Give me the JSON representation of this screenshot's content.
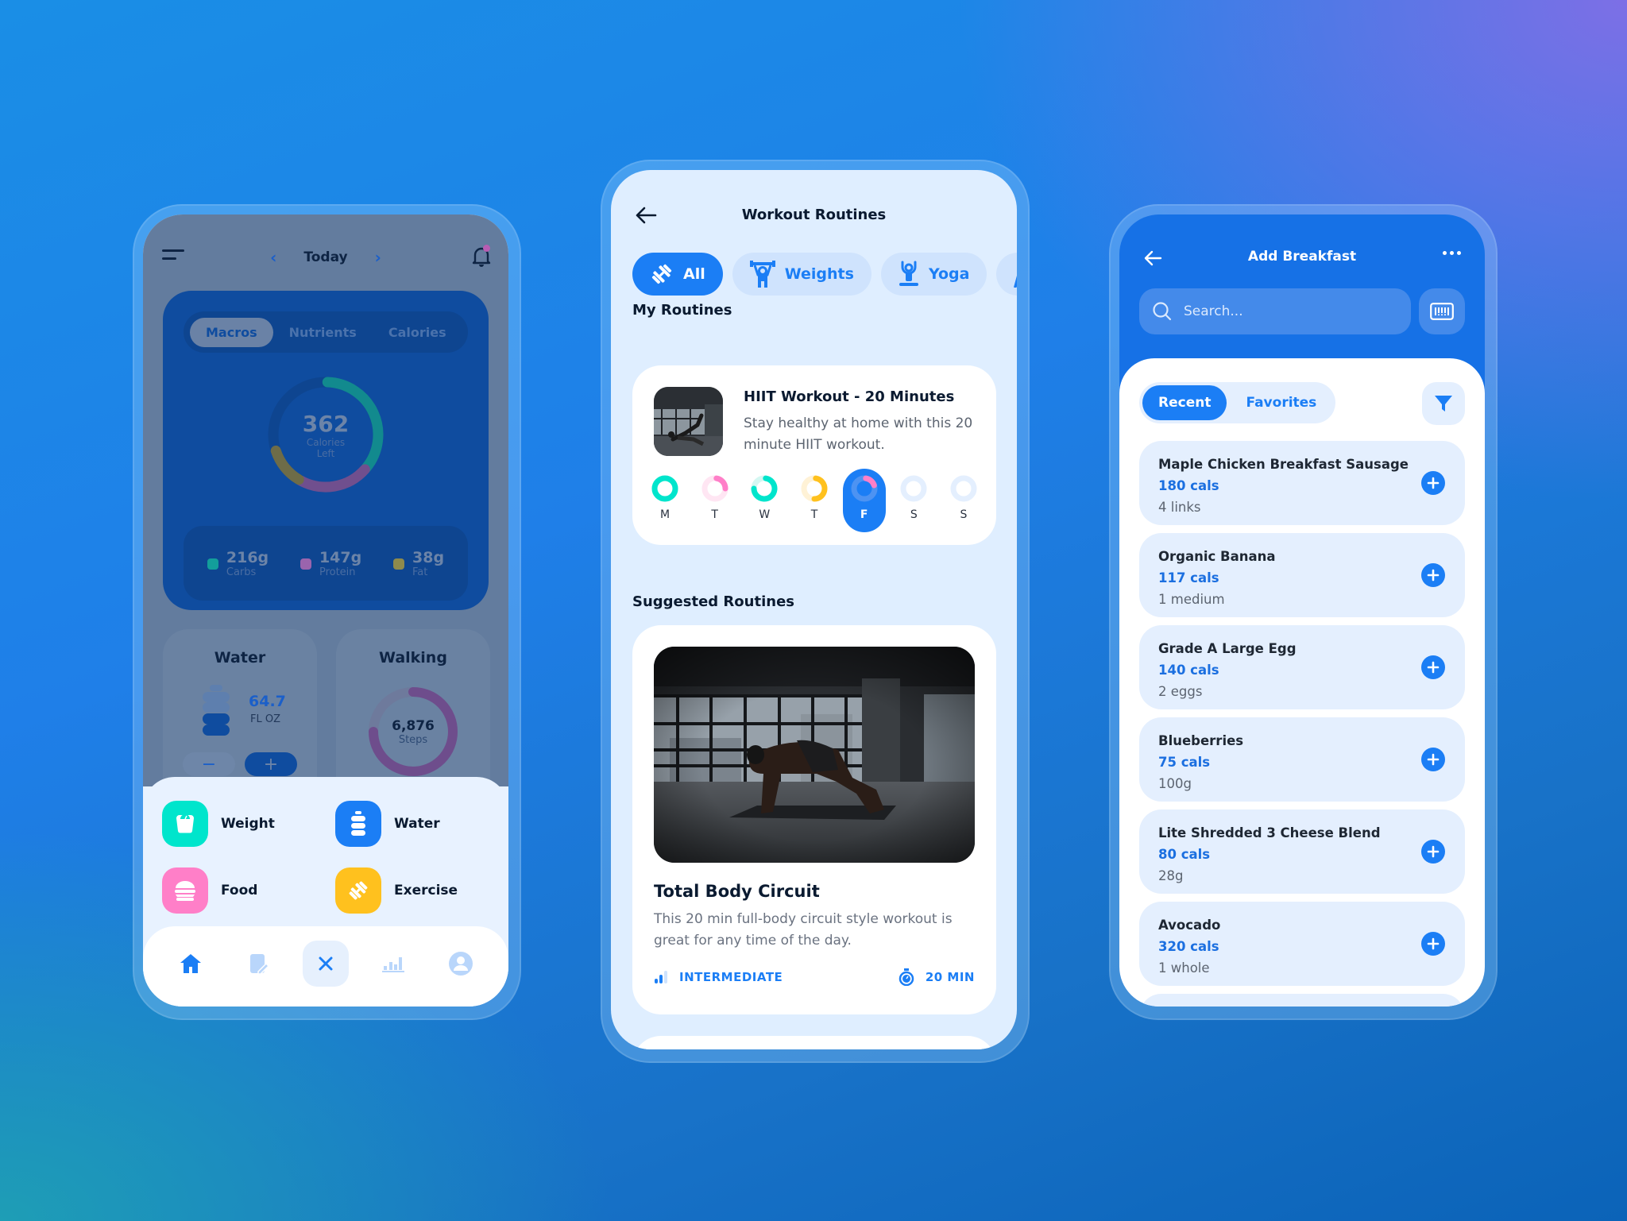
{
  "colors": {
    "primary": "#1b7ef5",
    "teal": "#00e5cc",
    "pink": "#ff7fc8",
    "yellow": "#ffc11e",
    "purple": "#7a4f8f"
  },
  "dashboard": {
    "date_label": "Today",
    "tabs": [
      {
        "label": "Macros",
        "active": true
      },
      {
        "label": "Nutrients",
        "active": false
      },
      {
        "label": "Calories",
        "active": false
      }
    ],
    "calories_left": {
      "value": "362",
      "label_line1": "Calories",
      "label_line2": "Left"
    },
    "macro_ring_fractions": {
      "carbs": 0.36,
      "protein": 0.22,
      "fat": 0.12
    },
    "macros": [
      {
        "value": "216g",
        "label": "Carbs",
        "color": "#139e9b"
      },
      {
        "value": "147g",
        "label": "Protein",
        "color": "#9a64ad"
      },
      {
        "value": "38g",
        "label": "Fat",
        "color": "#8e8a4c"
      }
    ],
    "water": {
      "title": "Water",
      "value": "64.7",
      "unit": "FL OZ",
      "minus": "−",
      "plus": "+"
    },
    "walking": {
      "title": "Walking",
      "value": "6,876",
      "unit": "Steps",
      "progress": 0.75
    },
    "quick_actions": [
      {
        "label": "Weight",
        "icon": "scale-icon",
        "color": "#00e5cc"
      },
      {
        "label": "Water",
        "icon": "bottle-icon",
        "color": "#1b7ef5"
      },
      {
        "label": "Food",
        "icon": "burger-icon",
        "color": "#ff7fc8"
      },
      {
        "label": "Exercise",
        "icon": "dumbbell-icon",
        "color": "#ffc11e"
      }
    ],
    "nav": [
      "home-icon",
      "diary-icon",
      "close-icon",
      "stats-icon",
      "profile-icon"
    ]
  },
  "workouts": {
    "title": "Workout Routines",
    "categories": [
      {
        "label": "All",
        "active": true
      },
      {
        "label": "Weights",
        "active": false
      },
      {
        "label": "Yoga",
        "active": false
      },
      {
        "label": "",
        "active": false
      }
    ],
    "my_routines_title": "My Routines",
    "routine": {
      "name": "HIIT Workout - 20 Minutes",
      "description": "Stay healthy at home with this 20 minute HIIT workout."
    },
    "days": [
      {
        "label": "M",
        "progress": 1.0,
        "color": "#00e5cc",
        "track": "#c9f6ef"
      },
      {
        "label": "T",
        "progress": 0.25,
        "color": "#ff7fc8",
        "track": "#ffe6f3"
      },
      {
        "label": "W",
        "progress": 0.75,
        "color": "#00e5cc",
        "track": "#d4f7f2"
      },
      {
        "label": "T",
        "progress": 0.5,
        "color": "#ffc11e",
        "track": "#fff2d6"
      },
      {
        "label": "F",
        "progress": 0.2,
        "color": "#ff7fc8",
        "track": "#4d93f2",
        "active": true
      },
      {
        "label": "S",
        "progress": 0,
        "color": "#1b7ef5",
        "track": "#e4effe"
      },
      {
        "label": "S",
        "progress": 0,
        "color": "#1b7ef5",
        "track": "#e4effe"
      }
    ],
    "suggested_title": "Suggested Routines",
    "suggested": {
      "name": "Total Body Circuit",
      "description": "This 20 min full-body circuit style workout is great for any time of the day.",
      "level": "INTERMEDIATE",
      "duration": "20 MIN"
    }
  },
  "breakfast": {
    "title": "Add Breakfast",
    "search_placeholder": "Search...",
    "toggle": [
      {
        "label": "Recent",
        "active": true
      },
      {
        "label": "Favorites",
        "active": false
      }
    ],
    "foods": [
      {
        "name": "Maple Chicken Breakfast Sausage",
        "cals": "180 cals",
        "serving": "4 links"
      },
      {
        "name": "Organic Banana",
        "cals": "117 cals",
        "serving": "1 medium"
      },
      {
        "name": "Grade A Large Egg",
        "cals": "140 cals",
        "serving": "2 eggs"
      },
      {
        "name": "Blueberries",
        "cals": "75 cals",
        "serving": "100g"
      },
      {
        "name": "Lite Shredded 3 Cheese Blend",
        "cals": "80 cals",
        "serving": "28g"
      },
      {
        "name": "Avocado",
        "cals": "320 cals",
        "serving": "1 whole"
      }
    ]
  }
}
